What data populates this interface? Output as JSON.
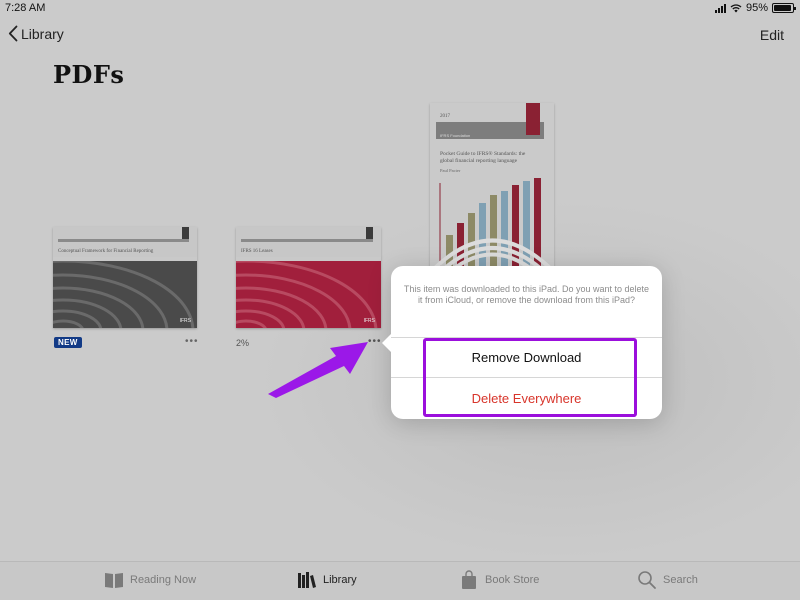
{
  "status_bar": {
    "time": "7:28 AM",
    "battery_percent": "95%",
    "battery_level": 0.95
  },
  "nav": {
    "back_label": "Library",
    "edit_label": "Edit"
  },
  "page": {
    "title": "PDFs"
  },
  "books": [
    {
      "title": "Conceptual Framework for Financial Reporting",
      "badge": "NEW",
      "logo": "IFRS",
      "more_icon": "ellipsis-icon"
    },
    {
      "title": "IFRS 16 Leases",
      "progress": "2%",
      "logo": "IFRS",
      "more_icon": "ellipsis-icon"
    },
    {
      "year": "2017",
      "band_text": "IFRS Foundation",
      "title": "Pocket Guide to IFRS® Standards: the global financial reporting language",
      "author": "Paul Pacter"
    }
  ],
  "popover": {
    "message": "This item was downloaded to this iPad. Do you want to delete it from iCloud, or remove the download from this iPad?",
    "remove_label": "Remove Download",
    "delete_label": "Delete Everywhere"
  },
  "annotation": {
    "highlight_color": "#9b0fdc",
    "arrow_color": "#9b18e8"
  },
  "tab_bar": {
    "items": [
      {
        "label": "Reading Now",
        "icon": "open-book-icon"
      },
      {
        "label": "Library",
        "icon": "library-books-icon",
        "selected": true
      },
      {
        "label": "Book Store",
        "icon": "shopping-bag-icon"
      },
      {
        "label": "Search",
        "icon": "search-icon"
      }
    ]
  },
  "colors": {
    "delete_red": "#d8352b",
    "badge_blue": "#123a86",
    "book_red": "#a11f3c"
  }
}
